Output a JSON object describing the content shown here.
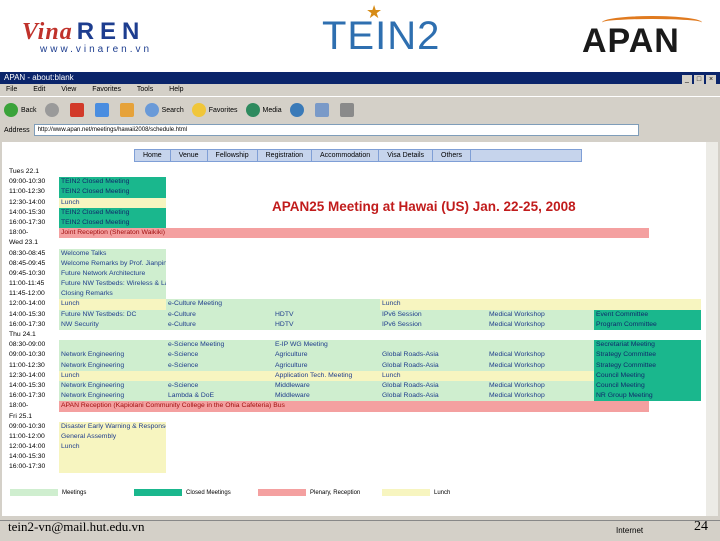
{
  "logos": {
    "vina_brand": "Vina",
    "vina_ren": "REN",
    "vina_url": "www.vinaren.vn",
    "tein": "TEIN2",
    "apan": "APAN"
  },
  "browser": {
    "title": "APAN - about:blank",
    "menu": [
      "File",
      "Edit",
      "View",
      "Favorites",
      "Tools",
      "Help"
    ],
    "toolbar": {
      "back": "Back",
      "search": "Search",
      "favorites": "Favorites",
      "media": "Media"
    },
    "address_label": "Address",
    "address": "http://www.apan.net/meetings/hawaii2008/schedule.html"
  },
  "page": {
    "nav": [
      "Home",
      "Venue",
      "Fellowship",
      "Registration",
      "Accommodation",
      "Visa Details",
      "Others"
    ],
    "title": "APAN25 Meeting at Hawai (US) Jan. 22-25, 2008",
    "legend": [
      "Meetings",
      "Closed Meetings",
      "Plenary, Reception",
      "Lunch"
    ]
  },
  "schedule": [
    {
      "day": "Tues 22.1"
    },
    {
      "time": "09:00-10:30",
      "cells": [
        {
          "text": "TEIN2 Closed Meeting",
          "cls": "d"
        }
      ]
    },
    {
      "time": "11:00-12:30",
      "cells": [
        {
          "text": "TEIN2 Closed Meeting",
          "cls": "d"
        }
      ]
    },
    {
      "time": "12:30-14:00",
      "cells": [
        {
          "text": "Lunch",
          "cls": "y"
        }
      ]
    },
    {
      "time": "14:00-15:30",
      "cells": [
        {
          "text": "TEIN2 Closed Meeting",
          "cls": "d"
        }
      ]
    },
    {
      "time": "16:00-17:30",
      "cells": [
        {
          "text": "TEIN2 Closed Meeting",
          "cls": "d"
        }
      ]
    },
    {
      "time": "18:00-",
      "cells": [
        {
          "text": "Joint Reception (Sheraton Waikiki)",
          "cls": "p",
          "wide": true
        }
      ]
    },
    {
      "day": "Wed 23.1"
    },
    {
      "time": "08:30-08:45",
      "cells": [
        {
          "text": "Welcome Talks",
          "cls": "g"
        }
      ]
    },
    {
      "time": "08:45-09:45",
      "cells": [
        {
          "text": "Welcome Remarks by Prof. Jianping Wu",
          "cls": "g"
        }
      ]
    },
    {
      "time": "09:45-10:30",
      "cells": [
        {
          "text": "Future Network Architecture",
          "cls": "g"
        }
      ]
    },
    {
      "time": "11:00-11:45",
      "cells": [
        {
          "text": "Future NW Testbeds: Wireless & Lambda",
          "cls": "g"
        }
      ]
    },
    {
      "time": "11:45-12:00",
      "cells": [
        {
          "text": "Closing Remarks",
          "cls": "g"
        }
      ]
    },
    {
      "time": "12:00-14:00",
      "cells": [
        {
          "text": "Lunch",
          "cls": "y"
        },
        {
          "text": "e-Culture Meeting",
          "cls": "g"
        },
        {
          "text": "",
          "cls": "g"
        },
        {
          "text": "Lunch",
          "cls": "y"
        },
        {
          "text": "",
          "cls": "y"
        },
        {
          "text": "",
          "cls": "y"
        }
      ]
    },
    {
      "time": "14:00-15:30",
      "cells": [
        {
          "text": "Future NW Testbeds: DC",
          "cls": "g"
        },
        {
          "text": "e-Culture",
          "cls": "g"
        },
        {
          "text": "HDTV",
          "cls": "g"
        },
        {
          "text": "IPv6 Session",
          "cls": "g"
        },
        {
          "text": "Medical Workshop",
          "cls": "g"
        },
        {
          "text": "Event Committee",
          "cls": "d"
        }
      ]
    },
    {
      "time": "16:00-17:30",
      "cells": [
        {
          "text": "NW Security",
          "cls": "g"
        },
        {
          "text": "e-Culture",
          "cls": "g"
        },
        {
          "text": "HDTV",
          "cls": "g"
        },
        {
          "text": "IPv6 Session",
          "cls": "g"
        },
        {
          "text": "Medical Workshop",
          "cls": "g"
        },
        {
          "text": "Program Committee",
          "cls": "d"
        }
      ]
    },
    {
      "day": "Thu 24.1"
    },
    {
      "time": "08:30-09:00",
      "cells": [
        {
          "text": "",
          "cls": "g"
        },
        {
          "text": "e-Science Meeting",
          "cls": "g"
        },
        {
          "text": "E-IP WG Meeting",
          "cls": "g"
        },
        {
          "text": "",
          "cls": "g"
        },
        {
          "text": "",
          "cls": "g"
        },
        {
          "text": "Secretariat Meeting",
          "cls": "d"
        }
      ]
    },
    {
      "time": "09:00-10:30",
      "cells": [
        {
          "text": "Network Engineering",
          "cls": "g"
        },
        {
          "text": "e-Science",
          "cls": "g"
        },
        {
          "text": "Agriculture",
          "cls": "g"
        },
        {
          "text": "Global Roads-Asia",
          "cls": "g"
        },
        {
          "text": "Medical Workshop",
          "cls": "g"
        },
        {
          "text": "Strategy Committee",
          "cls": "d"
        }
      ]
    },
    {
      "time": "11:00-12:30",
      "cells": [
        {
          "text": "Network Engineering",
          "cls": "g"
        },
        {
          "text": "e-Science",
          "cls": "g"
        },
        {
          "text": "Agriculture",
          "cls": "g"
        },
        {
          "text": "Global Roads-Asia",
          "cls": "g"
        },
        {
          "text": "Medical Workshop",
          "cls": "g"
        },
        {
          "text": "Strategy Committee",
          "cls": "d"
        }
      ]
    },
    {
      "time": "12:30-14:00",
      "cells": [
        {
          "text": "Lunch",
          "cls": "y"
        },
        {
          "text": "",
          "cls": "y"
        },
        {
          "text": "Application Tech. Meeting",
          "cls": "y"
        },
        {
          "text": "Lunch",
          "cls": "y"
        },
        {
          "text": "",
          "cls": "y"
        },
        {
          "text": "Council Meeting",
          "cls": "d"
        }
      ]
    },
    {
      "time": "14:00-15:30",
      "cells": [
        {
          "text": "Network Engineering",
          "cls": "g"
        },
        {
          "text": "e-Science",
          "cls": "g"
        },
        {
          "text": "Middleware",
          "cls": "g"
        },
        {
          "text": "Global Roads-Asia",
          "cls": "g"
        },
        {
          "text": "Medical Workshop",
          "cls": "g"
        },
        {
          "text": "Council Meeting",
          "cls": "d"
        }
      ]
    },
    {
      "time": "16:00-17:30",
      "cells": [
        {
          "text": "Network Engineering",
          "cls": "g"
        },
        {
          "text": "Lambda & DoE",
          "cls": "g"
        },
        {
          "text": "Middleware",
          "cls": "g"
        },
        {
          "text": "Global Roads-Asia",
          "cls": "g"
        },
        {
          "text": "Medical Workshop",
          "cls": "g"
        },
        {
          "text": "NR Group Meeting",
          "cls": "d"
        }
      ]
    },
    {
      "time": "18:00-",
      "cells": [
        {
          "text": "APAN Reception (Kapiolani Community College in the Ohia Cafeteria) Bus",
          "cls": "p",
          "wide": true
        }
      ]
    },
    {
      "day": "Fri 25.1"
    },
    {
      "time": "09:00-10:30",
      "cells": [
        {
          "text": "Disaster Early Warning & Response",
          "cls": "y"
        }
      ]
    },
    {
      "time": "11:00-12:00",
      "cells": [
        {
          "text": "General Assembly",
          "cls": "y"
        }
      ]
    },
    {
      "time": "12:00-14:00",
      "cells": [
        {
          "text": "Lunch",
          "cls": "y"
        }
      ]
    },
    {
      "time": "14:00-15:30",
      "cells": [
        {
          "text": "",
          "cls": "y"
        }
      ]
    },
    {
      "time": "16:00-17:30",
      "cells": [
        {
          "text": "",
          "cls": "y"
        }
      ]
    }
  ],
  "colors": {
    "meetings": "#cfeecf",
    "closed": "#1ab78d",
    "plenary": "#f4a0a0",
    "lunch": "#f7f5c0",
    "title": "#c11c1c"
  },
  "statusbar": {
    "zone": "Internet"
  },
  "footer": {
    "email": "tein2-vn@mail.hut.edu.vn",
    "page": "24"
  }
}
